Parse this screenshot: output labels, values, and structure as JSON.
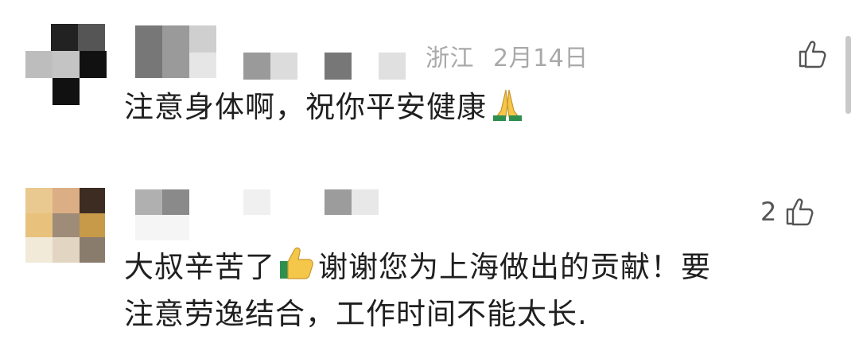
{
  "comments": [
    {
      "location": "浙江",
      "date": "2月14日",
      "text": "注意身体啊，祝你平安健康",
      "emoji": "folded-hands-emoji",
      "like_count": ""
    },
    {
      "location": "",
      "date": "",
      "like_count": "2",
      "text_part1": "大叔辛苦了",
      "emoji": "thumbs-up-emoji",
      "text_part2": "谢谢您为上海做出的贡献！要",
      "text_line2": "注意劳逸结合，工作时间不能太长."
    }
  ],
  "colors": {
    "text": "#1f1f1f",
    "meta": "#a9a9a9",
    "icon": "#555555"
  }
}
